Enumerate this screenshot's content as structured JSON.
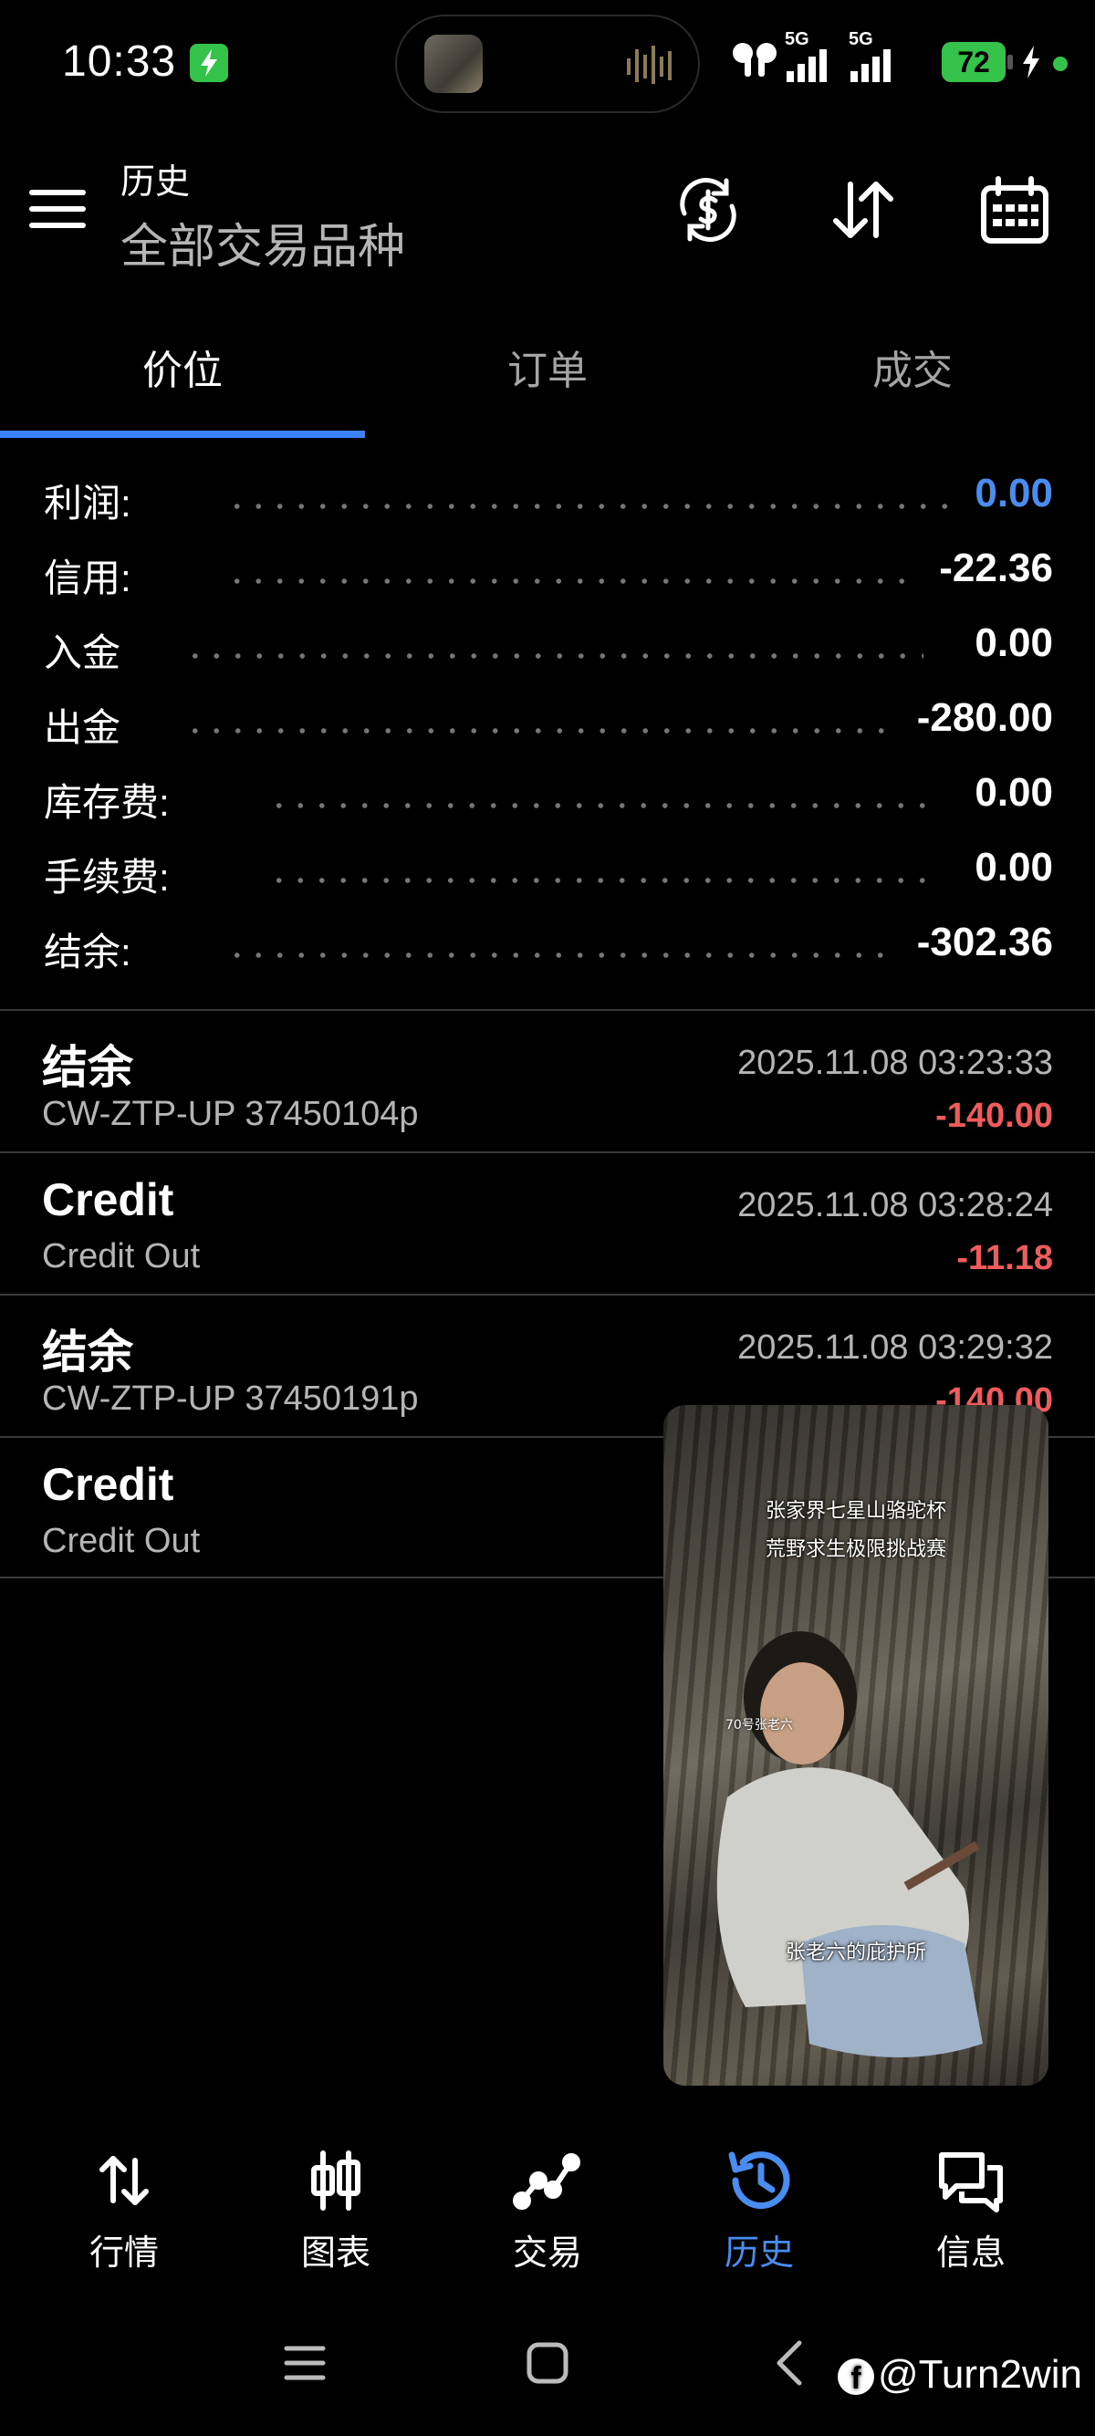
{
  "status_bar": {
    "time": "10:33",
    "battery": "72",
    "network_1": "5G",
    "network_2": "5G"
  },
  "header": {
    "title": "历史",
    "subtitle": "全部交易品种",
    "icons": [
      "currency-sync-icon",
      "sort-icon",
      "calendar-icon"
    ]
  },
  "tabs": [
    {
      "label": "价位",
      "active": true
    },
    {
      "label": "订单",
      "active": false
    },
    {
      "label": "成交",
      "active": false
    }
  ],
  "summary": [
    {
      "label": "利润:",
      "value": "0.00",
      "color": "#4a8df0"
    },
    {
      "label": "信用:",
      "value": "-22.36"
    },
    {
      "label": "入金",
      "value": "0.00"
    },
    {
      "label": "出金",
      "value": "-280.00"
    },
    {
      "label": "库存费:",
      "value": "0.00"
    },
    {
      "label": "手续费:",
      "value": "0.00"
    },
    {
      "label": "结余:",
      "value": "-302.36"
    }
  ],
  "deals": [
    {
      "type": "结余",
      "comment": "CW-ZTP-UP 37450104p",
      "time": "2025.11.08 03:23:33",
      "amount": "-140.00"
    },
    {
      "type": "Credit",
      "comment": "Credit Out",
      "time": "2025.11.08 03:28:24",
      "amount": "-11.18"
    },
    {
      "type": "结余",
      "comment": "CW-ZTP-UP 37450191p",
      "time": "2025.11.08 03:29:32",
      "amount": "-140.00"
    },
    {
      "type": "Credit",
      "comment": "Credit Out",
      "time": "",
      "amount": ""
    }
  ],
  "video_overlay": {
    "caption_1": "张家界七星山骆驼杯",
    "caption_2": "荒野求生极限挑战赛",
    "caption_3": "张老六的庇护所",
    "side_text": "70号张老六"
  },
  "bottom_nav": [
    {
      "label": "行情",
      "icon": "quotes-icon",
      "active": false
    },
    {
      "label": "图表",
      "icon": "chart-icon",
      "active": false
    },
    {
      "label": "交易",
      "icon": "trade-icon",
      "active": false
    },
    {
      "label": "历史",
      "icon": "history-icon",
      "active": true
    },
    {
      "label": "信息",
      "icon": "messages-icon",
      "active": false
    }
  ],
  "watermark": "@Turn2win",
  "colors": {
    "accent": "#3b82f6",
    "negative": "#f05b5b",
    "battery": "#35c24a"
  }
}
